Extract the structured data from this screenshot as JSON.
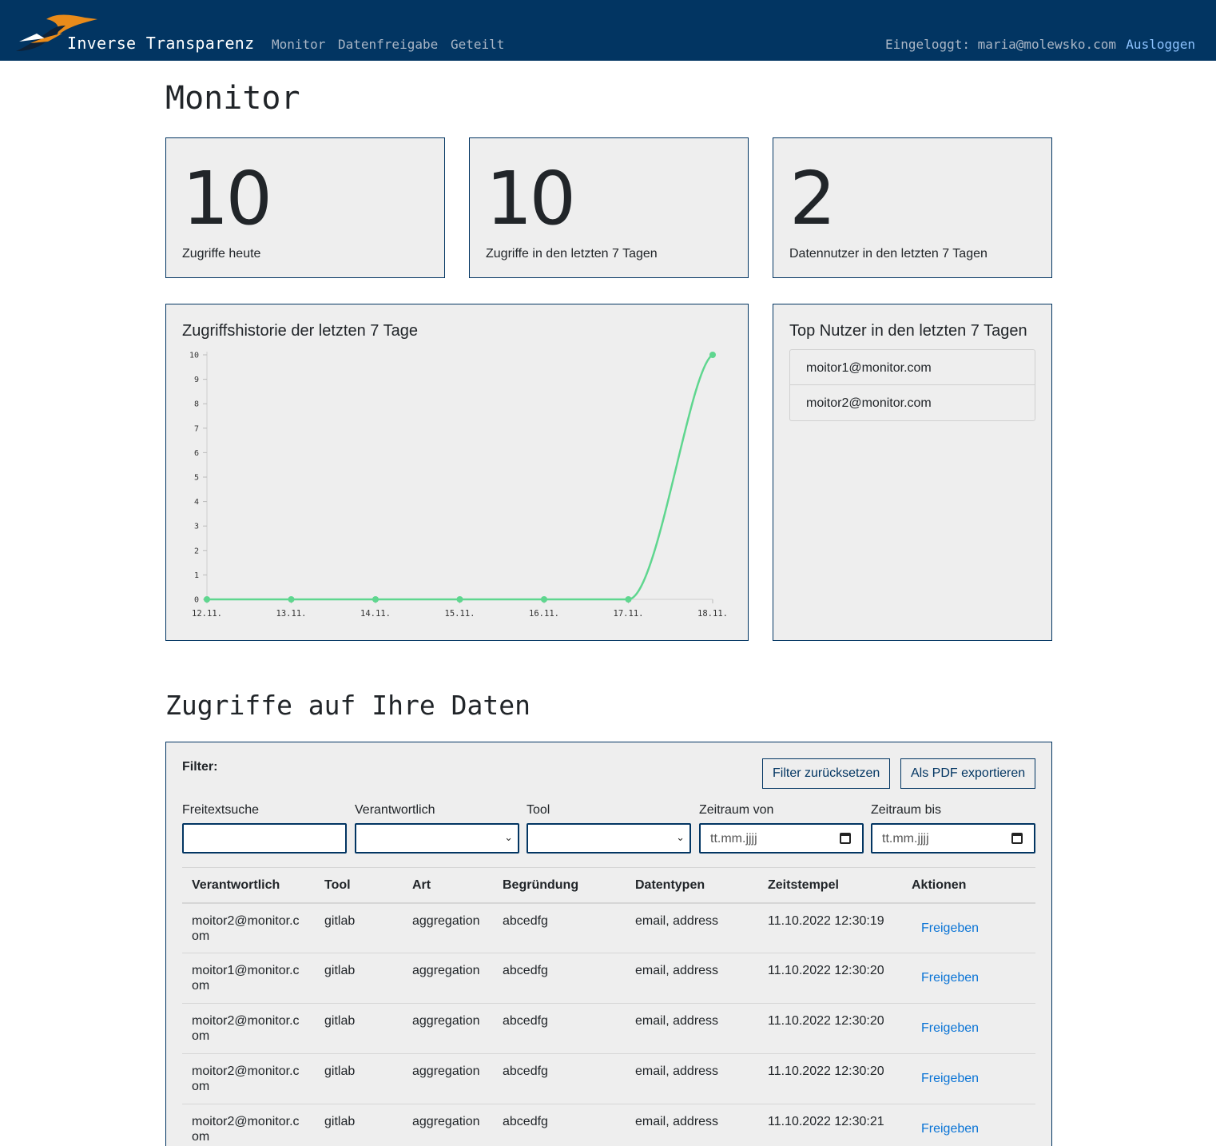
{
  "navbar": {
    "brand": "Inverse Transparenz",
    "links": [
      "Monitor",
      "Datenfreigabe",
      "Geteilt"
    ],
    "user": "Eingeloggt: maria@molewsko.com",
    "logout": "Ausloggen"
  },
  "page_title": "Monitor",
  "stats": [
    {
      "value": "10",
      "label": "Zugriffe heute"
    },
    {
      "value": "10",
      "label": "Zugriffe in den letzten 7 Tagen"
    },
    {
      "value": "2",
      "label": "Datennutzer in den letzten 7 Tagen"
    }
  ],
  "history": {
    "title": "Zugriffshistorie der letzten 7 Tage"
  },
  "chart_data": {
    "type": "line",
    "title": "Zugriffshistorie der letzten 7 Tage",
    "x": [
      "12.11.",
      "13.11.",
      "14.11.",
      "15.11.",
      "16.11.",
      "17.11.",
      "18.11."
    ],
    "values": [
      0,
      0,
      0,
      0,
      0,
      0,
      10
    ],
    "ylim": [
      0,
      10
    ],
    "yticks": [
      "0",
      "1",
      "2",
      "3",
      "4",
      "5",
      "6",
      "7",
      "8",
      "9",
      "10"
    ],
    "color": "#5fd68f",
    "grid": false
  },
  "top_users": {
    "title": "Top Nutzer in den letzten 7 Tagen",
    "items": [
      "moitor1@monitor.com",
      "moitor2@monitor.com"
    ]
  },
  "section_title": "Zugriffe auf Ihre Daten",
  "filter": {
    "label": "Filter:",
    "reset_button": "Filter zurücksetzen",
    "export_button": "Als PDF exportieren",
    "fields": {
      "freitext": "Freitextsuche",
      "verantwortlich": "Verantwortlich",
      "tool": "Tool",
      "von": "Zeitraum von",
      "bis": "Zeitraum bis"
    },
    "date_placeholder": "tt.mm.jjjj"
  },
  "table": {
    "columns": [
      "Verantwortlich",
      "Tool",
      "Art",
      "Begründung",
      "Datentypen",
      "Zeitstempel",
      "Aktionen"
    ],
    "rows": [
      {
        "verantwortlich": "moitor2@monitor.com",
        "tool": "gitlab",
        "art": "aggregation",
        "begruendung": "abcedfg",
        "datentypen": "email, address",
        "zeitstempel": "11.10.2022 12:30:19",
        "aktion": "Freigeben"
      },
      {
        "verantwortlich": "moitor1@monitor.com",
        "tool": "gitlab",
        "art": "aggregation",
        "begruendung": "abcedfg",
        "datentypen": "email, address",
        "zeitstempel": "11.10.2022 12:30:20",
        "aktion": "Freigeben"
      },
      {
        "verantwortlich": "moitor2@monitor.com",
        "tool": "gitlab",
        "art": "aggregation",
        "begruendung": "abcedfg",
        "datentypen": "email, address",
        "zeitstempel": "11.10.2022 12:30:20",
        "aktion": "Freigeben"
      },
      {
        "verantwortlich": "moitor2@monitor.com",
        "tool": "gitlab",
        "art": "aggregation",
        "begruendung": "abcedfg",
        "datentypen": "email, address",
        "zeitstempel": "11.10.2022 12:30:20",
        "aktion": "Freigeben"
      },
      {
        "verantwortlich": "moitor2@monitor.com",
        "tool": "gitlab",
        "art": "aggregation",
        "begruendung": "abcedfg",
        "datentypen": "email, address",
        "zeitstempel": "11.10.2022 12:30:21",
        "aktion": "Freigeben"
      }
    ]
  },
  "colors": {
    "navbar": "#023562",
    "card_bg": "#eeeeee",
    "link": "#0a74d6",
    "logo_orange": "#e98b1a"
  }
}
